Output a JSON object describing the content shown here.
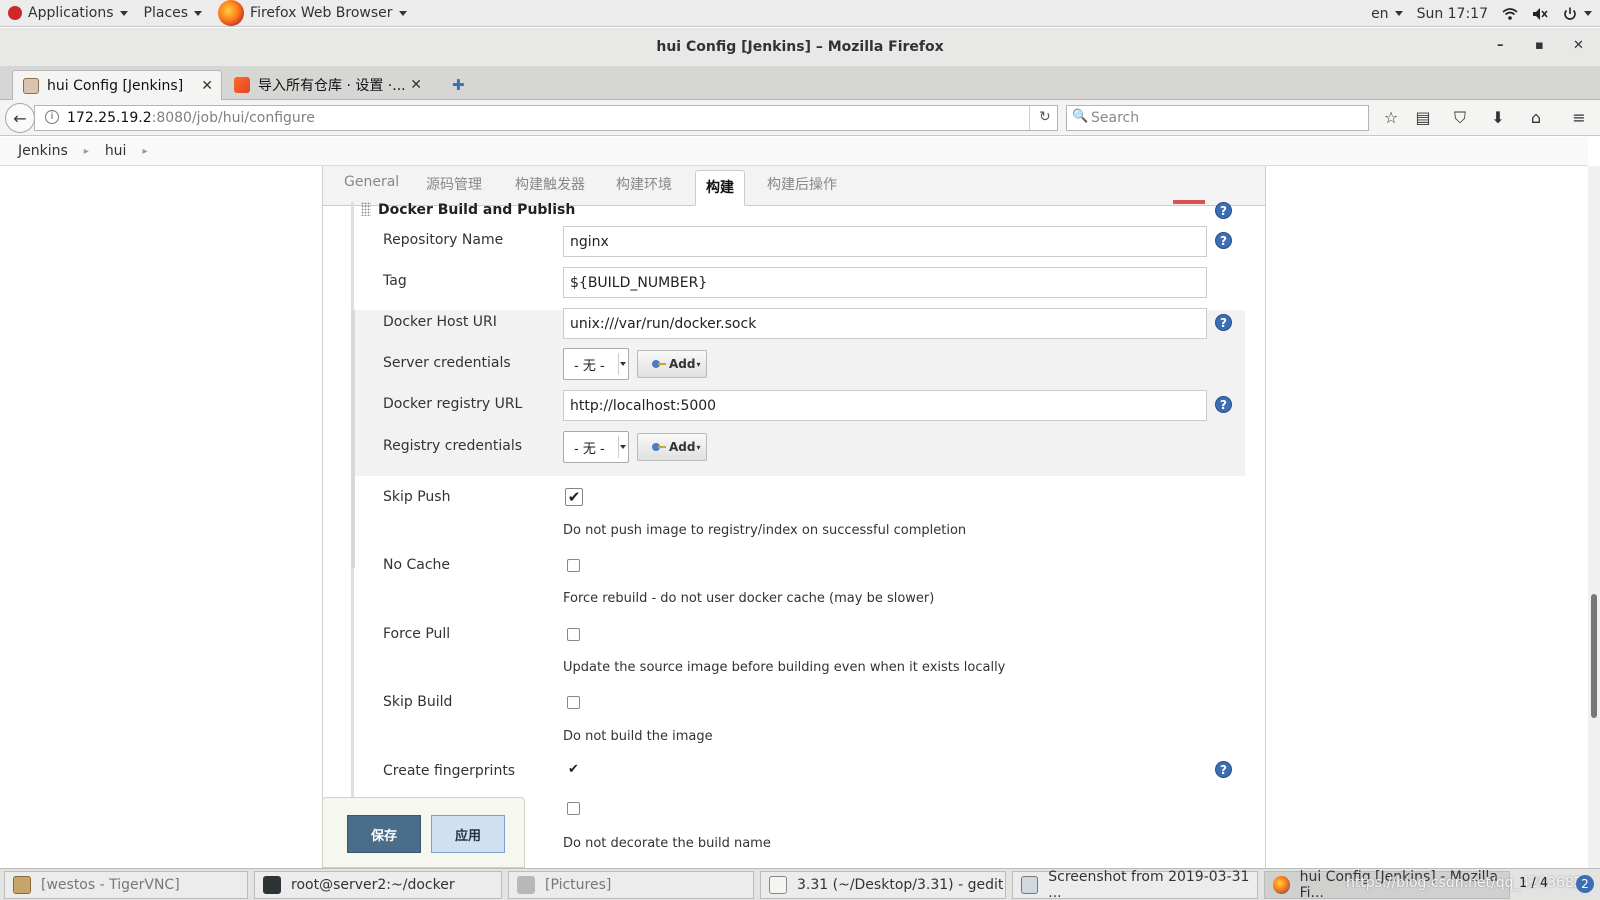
{
  "topbar": {
    "applications": "Applications",
    "places": "Places",
    "browser": "Firefox Web Browser",
    "lang": "en",
    "clock": "Sun 17:17"
  },
  "window": {
    "title": "hui Config [Jenkins] – Mozilla Firefox"
  },
  "tabs": [
    {
      "label": "hui Config [Jenkins]"
    },
    {
      "label": "导入所有仓库 · 设置 ·..."
    }
  ],
  "nav": {
    "url_host": "172.25.19.2",
    "url_path": ":8080/job/hui/configure",
    "search_placeholder": "Search"
  },
  "breadcrumb": {
    "items": [
      "Jenkins",
      "hui"
    ]
  },
  "config_tabs": [
    "General",
    "源码管理",
    "构建触发器",
    "构建环境",
    "构建",
    "构建后操作"
  ],
  "section": {
    "title": "Docker Build and Publish"
  },
  "form": {
    "repo_label": "Repository Name",
    "repo_value": "nginx",
    "tag_label": "Tag",
    "tag_value": "${BUILD_NUMBER}",
    "host_label": "Docker Host URI",
    "host_value": "unix:///var/run/docker.sock",
    "server_cred_label": "Server credentials",
    "server_cred_value": "- 无 -",
    "add_label": "Add",
    "registry_label": "Docker registry URL",
    "registry_value": "http://localhost:5000",
    "registry_cred_label": "Registry credentials",
    "registry_cred_value": "- 无 -",
    "skip_push_label": "Skip Push",
    "skip_push_desc": "Do not push image to registry/index on successful completion",
    "no_cache_label": "No Cache",
    "no_cache_desc": "Force rebuild - do not user docker cache (may be slower)",
    "force_pull_label": "Force Pull",
    "force_pull_desc": "Update the source image before building even when it exists locally",
    "skip_build_label": "Skip Build",
    "skip_build_desc": "Do not build the image",
    "fingerprints_label": "Create fingerprints",
    "skip_decorate_desc": "Do not decorate the build name",
    "skip_push_checked": true,
    "no_cache_checked": false,
    "force_pull_checked": false,
    "skip_build_checked": false,
    "fingerprints_checked": true,
    "skip_decorate_checked": false
  },
  "buttons": {
    "save": "保存",
    "apply": "应用"
  },
  "taskbar": {
    "items": [
      "[westos - TigerVNC]",
      "root@server2:~/docker",
      "[Pictures]",
      "3.31 (~/Desktop/3.31) - gedit",
      "Screenshot from 2019-03-31 ...",
      "hui Config [Jenkins] - Mozilla Fi..."
    ],
    "pager": "1 / 4",
    "watermark": "https://blog.csdn.net/qq_42036824"
  },
  "icons": {
    "help": "?",
    "close": "✕",
    "new_tab": "✚",
    "check": "✔"
  },
  "colors": {
    "help_blue": "#3c6eb4",
    "save_button": "#4a6d8a",
    "apply_button": "#cfe0f2"
  }
}
